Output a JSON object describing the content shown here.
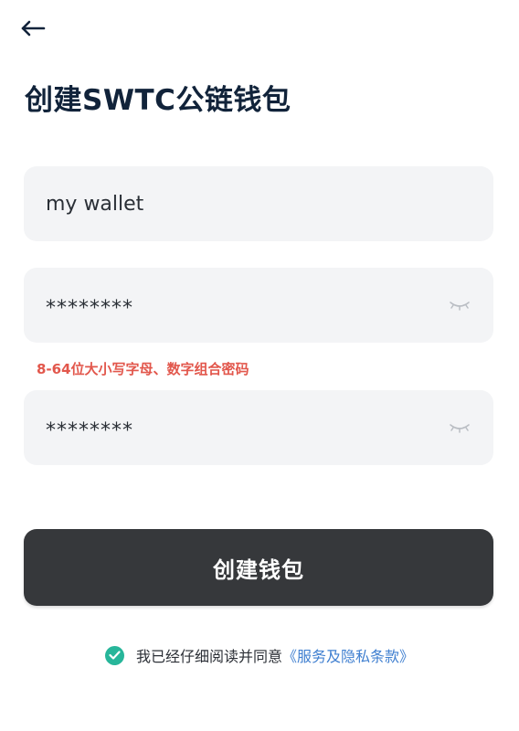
{
  "header": {
    "back_icon": "back-arrow-icon",
    "title": "创建SWTC公链钱包"
  },
  "form": {
    "wallet_name": {
      "value": "my wallet"
    },
    "password": {
      "value": "********",
      "eye_icon": "eye-closed-icon"
    },
    "password_hint": "8-64位大小写字母、数字组合密码",
    "confirm_password": {
      "value": "********",
      "eye_icon": "eye-closed-icon"
    }
  },
  "actions": {
    "create_label": "创建钱包"
  },
  "agreement": {
    "check_icon": "check-circle-icon",
    "text": "我已经仔细阅读并同意",
    "link": "《服务及隐私条款》"
  },
  "colors": {
    "title": "#11233a",
    "field_bg": "#f3f4f6",
    "hint": "#e2574c",
    "button_bg": "#36383b",
    "check": "#27b69a",
    "link": "#3f7fd0"
  }
}
